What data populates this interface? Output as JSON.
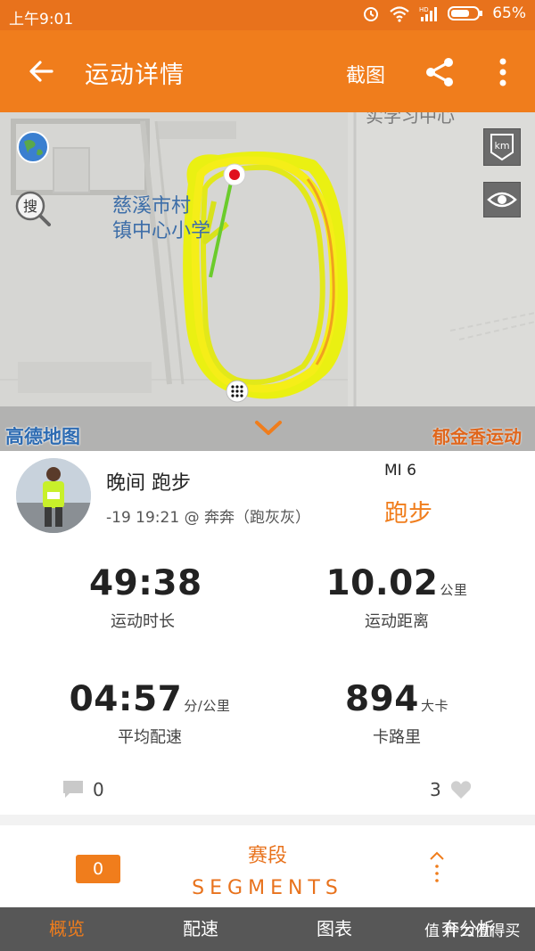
{
  "status_bar": {
    "time": "上午9:01",
    "battery": "65%",
    "network": "HD"
  },
  "app_bar": {
    "title": "运动详情",
    "screenshot_label": "截图"
  },
  "map": {
    "labels": [
      "慈溪市村",
      "镇中心小学"
    ],
    "top_label": "实学习中心",
    "provider": "高德地图",
    "brand": "郁金香运动",
    "km_label": "km",
    "search_label": "搜"
  },
  "activity": {
    "title": "晚间 跑步",
    "meta": "-19 19:21 @ 奔奔（跑灰灰）",
    "device": "MI 6",
    "type": "跑步"
  },
  "stats": {
    "duration": {
      "value": "49:38",
      "label": "运动时长"
    },
    "distance": {
      "value": "10.02",
      "unit": "公里",
      "label": "运动距离"
    },
    "pace": {
      "value": "04:57",
      "unit": "分/公里",
      "label": "平均配速"
    },
    "calories": {
      "value": "894",
      "unit": "大卡",
      "label": "卡路里"
    }
  },
  "social": {
    "comments": "0",
    "likes": "3"
  },
  "segments": {
    "count": "0",
    "title": "赛段",
    "subtitle": "SEGMENTS"
  },
  "nav": {
    "tabs": [
      "概览",
      "配速",
      "图表",
      "奔分析"
    ],
    "active": 0
  },
  "watermark": "值 什么值得买",
  "colors": {
    "accent": "#f07d1c",
    "track": "#f4f01a",
    "nav_bg": "#575757"
  }
}
